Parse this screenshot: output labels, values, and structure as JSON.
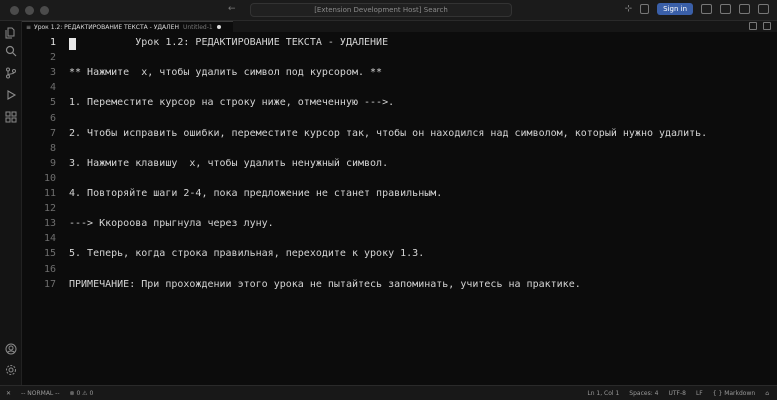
{
  "titlebar": {
    "command_center": "[Extension Development Host] Search",
    "sign_in_label": "Sign in",
    "nav_arrows": "← →",
    "copilot_glyph": "⊹"
  },
  "activity_bar": {
    "icons": [
      "explorer-icon",
      "search-icon",
      "source-control-icon",
      "run-debug-icon",
      "extensions-icon",
      "account-icon",
      "settings-gear-icon"
    ]
  },
  "tab": {
    "title": "Урок 1.2: РЕДАКТИРОВАНИЕ ТЕКСТА - УДАЛЕН",
    "description": "Untitled-1",
    "icon": "≡"
  },
  "editor": {
    "current_line": 1,
    "lines": [
      "           Урок 1.2: РЕДАКТИРОВАНИЕ ТЕКСТА - УДАЛЕНИЕ",
      "",
      "** Нажмите  x, чтобы удалить символ под курсором. **",
      "",
      "1. Переместите курсор на строку ниже, отмеченную --->.",
      "",
      "2. Чтобы исправить ошибки, переместите курсор так, чтобы он находился над символом, который нужно удалить.",
      "",
      "3. Нажмите клавишу  x, чтобы удалить ненужный символ.",
      "",
      "4. Повторяйте шаги 2-4, пока предложение не станет правильным.",
      "",
      "---> Ккороова прыгнула через луну.",
      "",
      "5. Теперь, когда строка правильная, переходите к уроку 1.3.",
      "",
      "ПРИМЕЧАНИЕ: При прохождении этого урока не пытайтесь запоминать, учитесь на практике."
    ]
  },
  "statusbar": {
    "remote": "✕",
    "vim_mode": "-- NORMAL --",
    "problems": "⊗ 0  ⚠ 0",
    "position": "Ln 1, Col 1",
    "spaces": "Spaces: 4",
    "encoding": "UTF-8",
    "eol": "LF",
    "language": "{ }  Markdown",
    "notifications": "⌂"
  }
}
